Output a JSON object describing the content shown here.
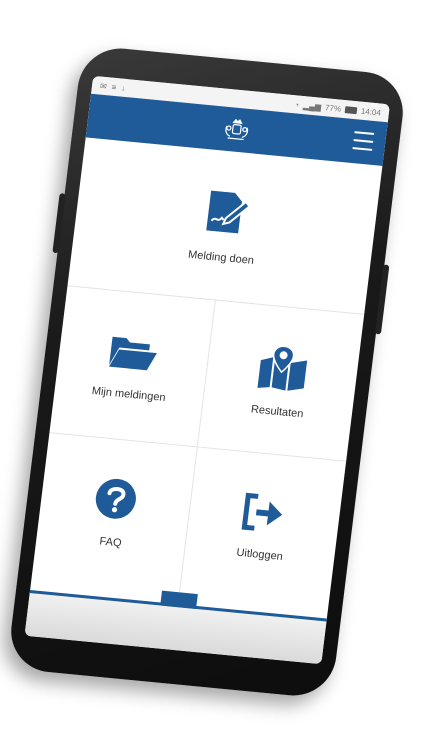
{
  "statusbar": {
    "left_icons": [
      "message-icon",
      "list-icon",
      "download-icon"
    ],
    "signal_text": "77%",
    "time": "14:04"
  },
  "appbar": {
    "logo": "royal-crest-icon",
    "menu_icon": "hamburger-menu-icon"
  },
  "tiles": {
    "report": {
      "label": "Melding doen",
      "icon": "edit-document-icon"
    },
    "my_reports": {
      "label": "Mijn meldingen",
      "icon": "folder-open-icon"
    },
    "results": {
      "label": "Resultaten",
      "icon": "map-location-icon"
    },
    "faq": {
      "label": "FAQ",
      "icon": "question-circle-icon"
    },
    "logout": {
      "label": "Uitloggen",
      "icon": "sign-out-icon"
    }
  },
  "colors": {
    "brand_blue": "#1f5b99",
    "background": "#ffffff",
    "device": "#1a1a1a"
  }
}
